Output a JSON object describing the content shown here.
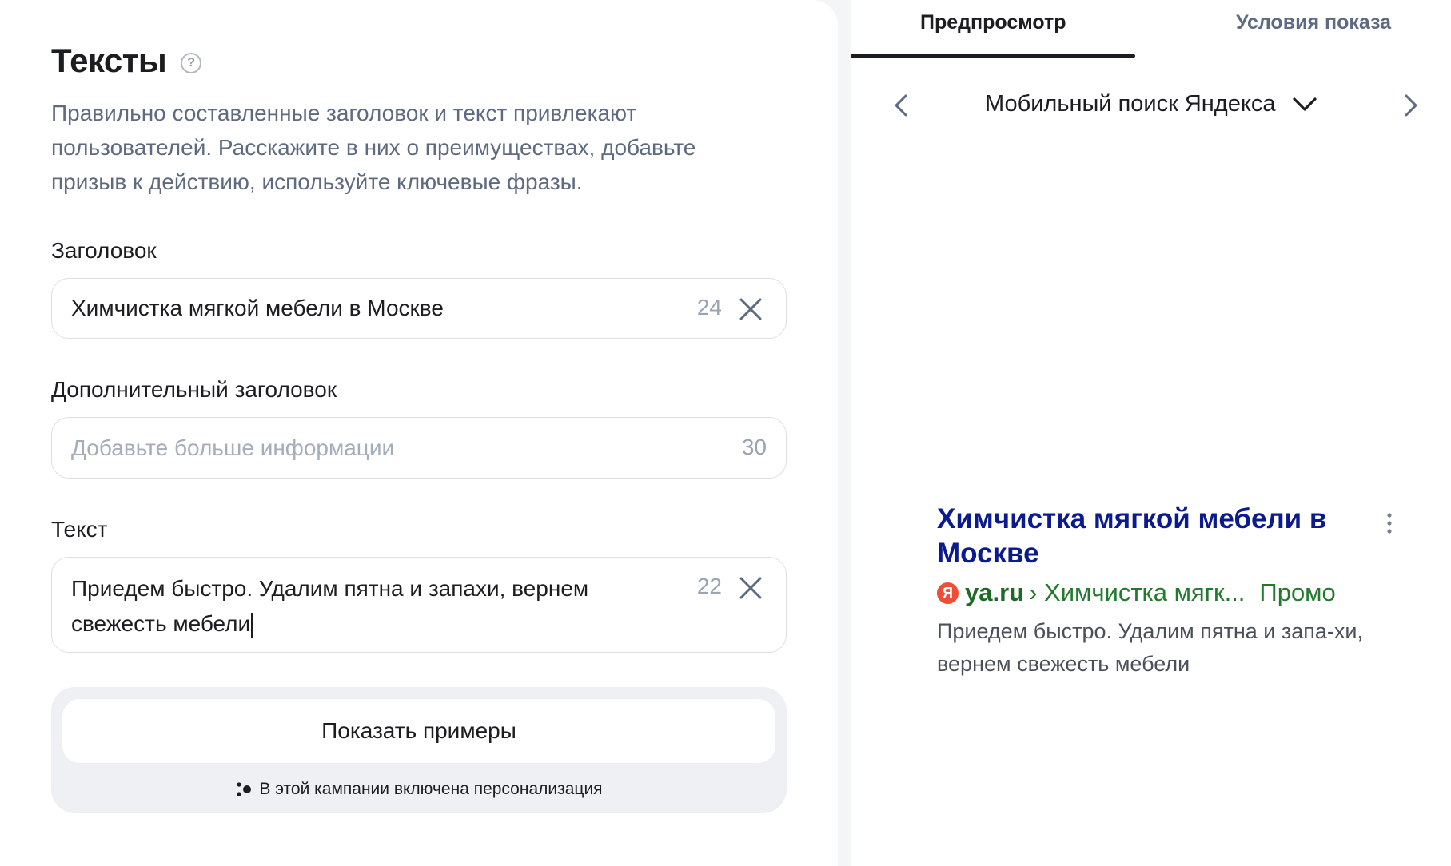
{
  "form": {
    "title": "Тексты",
    "help_icon": "question-circle-icon",
    "description": "Правильно составленные заголовок и текст привлекают пользователей. Расскажите в них о преимуществах, добавьте призыв к действию, используйте ключевые фразы.",
    "headline": {
      "label": "Заголовок",
      "value": "Химчистка мягкой мебели в Москве",
      "counter": "24"
    },
    "extra_headline": {
      "label": "Дополнительный заголовок",
      "placeholder": "Добавьте больше информации",
      "counter": "30"
    },
    "text": {
      "label": "Текст",
      "value": "Приедем быстро. Удалим пятна и запахи, вернем свежесть мебели",
      "counter": "22"
    },
    "examples_button": "Показать примеры",
    "personalization_note": "В этой кампании включена персонализация"
  },
  "preview": {
    "tabs": [
      {
        "label": "Предпросмотр",
        "active": true
      },
      {
        "label": "Условия показа",
        "active": false
      }
    ],
    "device": "Мобильный поиск Яндекса",
    "ad": {
      "title": "Химчистка мягкой мебели в Москве",
      "logo_letter": "Я",
      "domain": "ya.ru",
      "path": "› Химчистка мягк...",
      "badge": "Промо",
      "text": "Приедем быстро. Удалим пятна и запа-хи, вернем свежесть мебели"
    }
  },
  "colors": {
    "ad_title": "#0b1b8f",
    "ad_url": "#227a2c",
    "yandex_red": "#f04d37"
  }
}
